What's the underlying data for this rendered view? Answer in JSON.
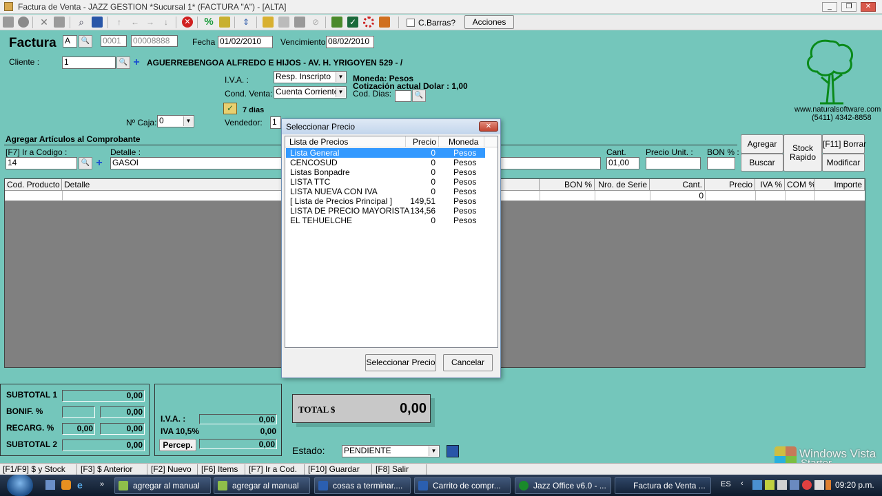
{
  "window": {
    "title": "Factura de Venta - JAZZ GESTION *Sucursal 1* (FACTURA \"A\") - [ALTA]"
  },
  "toolbar": {
    "cbarras_label": "C.Barras?",
    "acciones_label": "Acciones"
  },
  "header": {
    "factura_label": "Factura",
    "tipo": "A",
    "punto_venta": "0001",
    "numero": "00008888",
    "fecha_label": "Fecha :",
    "fecha": "01/02/2010",
    "vencimiento_label": "Vencimiento :",
    "vencimiento": "08/02/2010",
    "cliente_label": "Cliente :",
    "cliente_id": "1",
    "cliente_nombre": "AGUERREBENGOA ALFREDO E HIJOS - AV. H. YRIGOYEN 529 - /",
    "iva_label": "I.V.A. :",
    "iva_value": "Resp. Inscripto",
    "cond_venta_label": "Cond. Venta:",
    "cond_venta_value": "Cuenta Corriente",
    "moneda": "Moneda: Pesos",
    "cotizacion": "Cotización actual Dolar : 1,00",
    "cod_dias_label": "Cod. Dias:",
    "dias": "7 dias",
    "caja_label": "Nº Caja:",
    "caja_value": "0",
    "vendedor_label": "Vendedor:",
    "vendedor_value": "1"
  },
  "brand": {
    "website": "www.naturalsoftware.com.ar",
    "phone": "(5411) 4342-8858"
  },
  "articulos": {
    "section_title": "Agregar Artículos al Comprobante",
    "codigo_label": "[F7] Ir a Codigo :",
    "codigo_value": "14",
    "detalle_label": "Detalle :",
    "detalle_value": "GASOI",
    "cant_label": "Cant.",
    "cant_value": "01,00",
    "precio_label": "Precio Unit. :",
    "bon_label": "BON % :",
    "agregar": "Agregar",
    "buscar": "Buscar",
    "stock_rapido": "Stock Rapido",
    "borrar": "[F11] Borrar",
    "modificar": "Modificar"
  },
  "grid": {
    "headers": [
      "Cod. Producto",
      "Detalle",
      "BON %",
      "Nro. de Serie",
      "Cant.",
      "Precio",
      "IVA %",
      "COM %",
      "Importe"
    ],
    "cant_row_value": "0"
  },
  "dialog": {
    "title": "Seleccionar Precio",
    "columns": [
      "Lista de Precios",
      "Precio",
      "Moneda"
    ],
    "rows": [
      {
        "lista": "Lista General",
        "precio": "0",
        "moneda": "Pesos"
      },
      {
        "lista": "CENCOSUD",
        "precio": "0",
        "moneda": "Pesos"
      },
      {
        "lista": "Listas Bonpadre",
        "precio": "0",
        "moneda": "Pesos"
      },
      {
        "lista": "LISTA TTC",
        "precio": "0",
        "moneda": "Pesos"
      },
      {
        "lista": "LISTA NUEVA CON IVA",
        "precio": "0",
        "moneda": "Pesos"
      },
      {
        "lista": "[ Lista de Precios Principal ]",
        "precio": "149,51",
        "moneda": "Pesos"
      },
      {
        "lista": "LISTA DE PRECIO MAYORISTA",
        "precio": "134,56",
        "moneda": "Pesos"
      },
      {
        "lista": "EL TEHUELCHE",
        "precio": "0",
        "moneda": "Pesos"
      }
    ],
    "select_button": "Seleccionar Precio",
    "cancel_button": "Cancelar"
  },
  "totals": {
    "subtotal1_label": "SUBTOTAL 1",
    "subtotal1": "0,00",
    "bonif_label": "BONIF. %",
    "bonif": "0,00",
    "recarg_label": "RECARG. %",
    "recarg_pct": "0,00",
    "recarg": "0,00",
    "subtotal2_label": "SUBTOTAL 2",
    "subtotal2": "0,00",
    "iva_label": "I.V.A. :",
    "iva": "0,00",
    "iva105_label": "IVA 10,5%",
    "iva105": "0,00",
    "percep_label": "Percep.",
    "percep": "0,00",
    "total_label": "TOTAL $",
    "total": "0,00",
    "estado_label": "Estado:",
    "estado_value": "PENDIENTE"
  },
  "statusbar": [
    "[F1/F9] $ y Stock",
    "[F3] $ Anterior",
    "[F2] Nuevo",
    "[F6] Items",
    "[F7] Ir a Cod.",
    "[F10] Guardar",
    "[F8] Salir"
  ],
  "watermark": {
    "line1": "Windows Vista",
    "line2": "Starter"
  },
  "taskbar": {
    "tasks": [
      "agregar al manual",
      "agregar al manual",
      "cosas a terminar....",
      "Carrito de compr...",
      "Jazz Office v6.0 - ...",
      "Factura de Venta ..."
    ],
    "lang": "ES",
    "clock": "09:20 p.m."
  },
  "colors": {
    "background": "#74c6bb",
    "selection": "#3399ff",
    "grid_area": "#808080"
  }
}
